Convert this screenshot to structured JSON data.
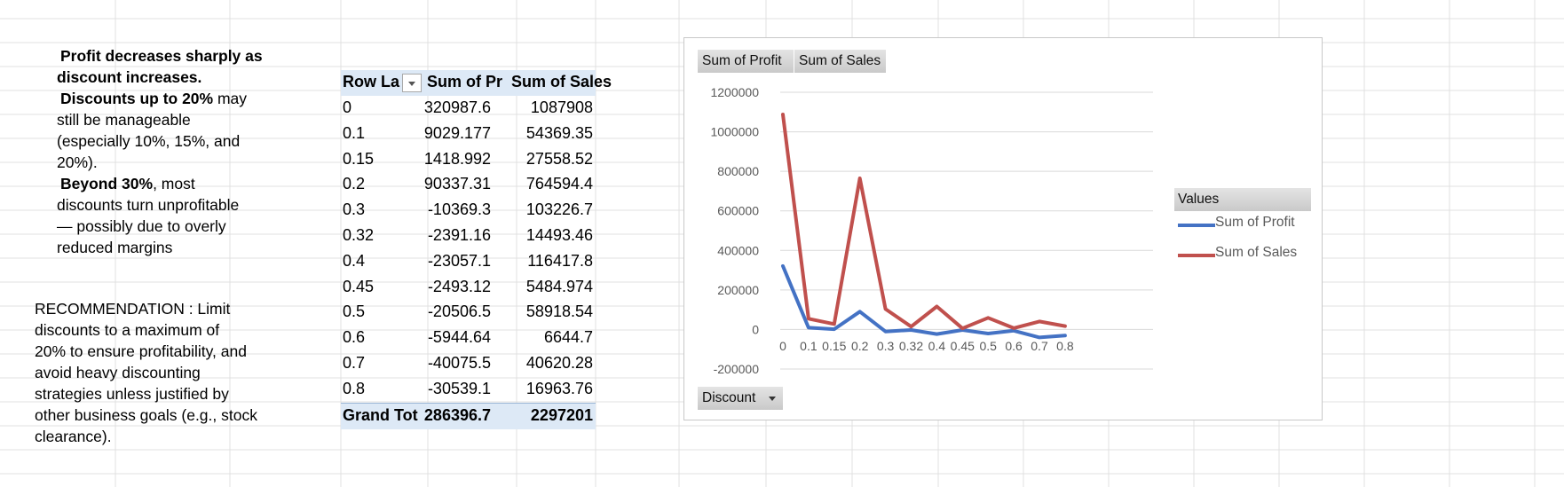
{
  "insights": {
    "lines": [
      {
        "bold": "Profit decreases sharply as",
        "rest": ""
      },
      {
        "bold": "discount increases.",
        "rest": ""
      },
      {
        "bold": "Discounts up to 20%",
        "rest": " may"
      },
      {
        "bold": "",
        "rest": "still be manageable"
      },
      {
        "bold": "",
        "rest": "(especially 10%, 15%, and"
      },
      {
        "bold": "",
        "rest": "20%)."
      },
      {
        "bold": "Beyond 30%",
        "rest": ", most"
      },
      {
        "bold": "",
        "rest": "discounts turn unprofitable"
      },
      {
        "bold": "",
        "rest": "— possibly due to overly"
      },
      {
        "bold": "",
        "rest": "reduced margins"
      }
    ]
  },
  "recommendation": {
    "lines": [
      "RECOMMENDATION : Limit",
      "discounts to a maximum of",
      "20% to ensure profitability, and",
      "avoid heavy discounting",
      "strategies unless justified by",
      "other business goals (e.g., stock",
      "clearance)."
    ]
  },
  "pivot": {
    "header": {
      "row_labels": "Row La",
      "profit": "Sum of Pr",
      "sales": "Sum of Sales"
    },
    "rows": [
      {
        "label": "0",
        "profit": "320987.6",
        "sales": "1087908"
      },
      {
        "label": "0.1",
        "profit": "9029.177",
        "sales": "54369.35"
      },
      {
        "label": "0.15",
        "profit": "1418.992",
        "sales": "27558.52"
      },
      {
        "label": "0.2",
        "profit": "90337.31",
        "sales": "764594.4"
      },
      {
        "label": "0.3",
        "profit": "-10369.3",
        "sales": "103226.7"
      },
      {
        "label": "0.32",
        "profit": "-2391.16",
        "sales": "14493.46"
      },
      {
        "label": "0.4",
        "profit": "-23057.1",
        "sales": "116417.8"
      },
      {
        "label": "0.45",
        "profit": "-2493.12",
        "sales": "5484.974"
      },
      {
        "label": "0.5",
        "profit": "-20506.5",
        "sales": "58918.54"
      },
      {
        "label": "0.6",
        "profit": "-5944.64",
        "sales": "6644.7"
      },
      {
        "label": "0.7",
        "profit": "-40075.5",
        "sales": "40620.28"
      },
      {
        "label": "0.8",
        "profit": "-30539.1",
        "sales": "16963.76"
      }
    ],
    "total": {
      "label": "Grand Tot",
      "profit": "286396.7",
      "sales": "2297201"
    }
  },
  "chart": {
    "field_buttons": {
      "profit": "Sum of Profit",
      "sales": "Sum of Sales",
      "axis_field": "Discount"
    },
    "legend_title": "Values"
  },
  "chart_data": {
    "type": "line",
    "categories": [
      "0",
      "0.1",
      "0.15",
      "0.2",
      "0.3",
      "0.32",
      "0.4",
      "0.45",
      "0.5",
      "0.6",
      "0.7",
      "0.8"
    ],
    "series": [
      {
        "name": "Sum of Profit",
        "color": "#4472c4",
        "values": [
          320987.6,
          9029.177,
          1418.992,
          90337.31,
          -10369.3,
          -2391.16,
          -23057.1,
          -2493.12,
          -20506.5,
          -5944.64,
          -40075.5,
          -30539.1
        ]
      },
      {
        "name": "Sum of Sales",
        "color": "#c0504d",
        "values": [
          1087908,
          54369.35,
          27558.52,
          764594.4,
          103226.7,
          14493.46,
          116417.8,
          5484.974,
          58918.54,
          6644.7,
          40620.28,
          16963.76
        ]
      }
    ],
    "yticks": [
      "1200000",
      "1000000",
      "800000",
      "600000",
      "400000",
      "200000",
      "0",
      "-200000"
    ],
    "ylim": [
      -200000,
      1200000
    ],
    "grid": true,
    "legend_position": "right"
  }
}
